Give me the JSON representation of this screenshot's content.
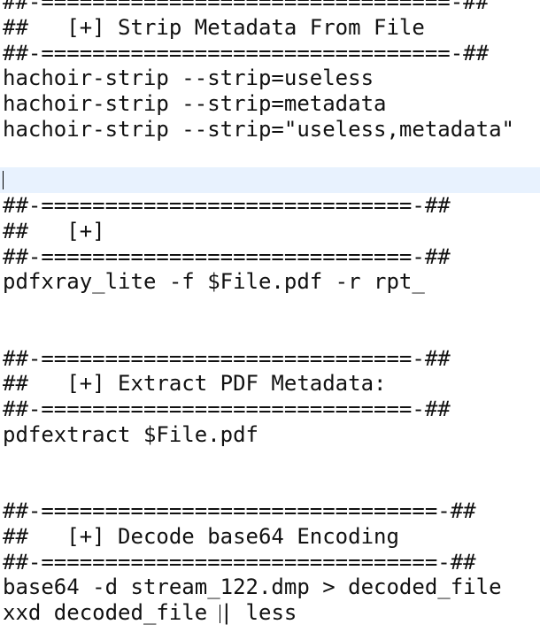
{
  "editor": {
    "lines": [
      "##-================================-##",
      "##   [+] Strip Metadata From File",
      "##-================================-##",
      "hachoir-strip --strip=useless",
      "hachoir-strip --strip=metadata",
      "hachoir-strip --strip=\"useless,metadata\"",
      "",
      "",
      "##-=============================-##",
      "##   [+]",
      "##-=============================-##",
      "pdfxray_lite -f $File.pdf -r rpt_",
      "",
      "",
      "##-=============================-##",
      "##   [+] Extract PDF Metadata:",
      "##-=============================-##",
      "pdfextract $File.pdf",
      "",
      "",
      "##-===============================-##",
      "##   [+] Decode base64 Encoding",
      "##-===============================-##",
      "base64 -d stream_122.dmp > decoded_file",
      "xxd decoded_file ",
      "| less"
    ]
  }
}
